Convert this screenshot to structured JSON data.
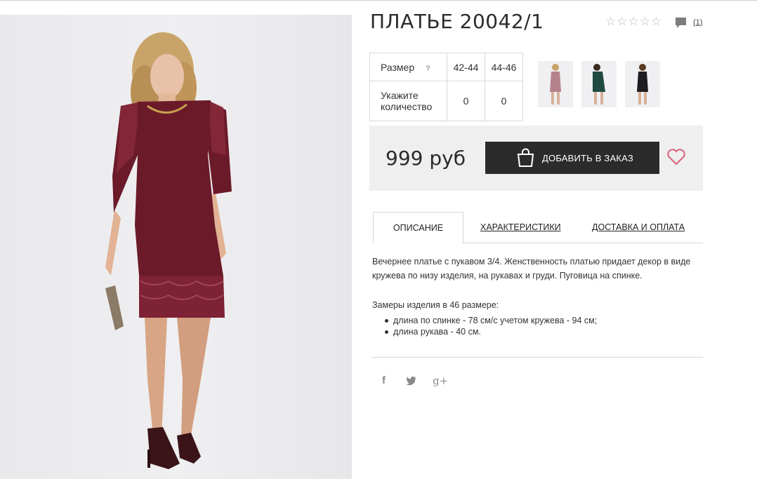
{
  "product": {
    "title": "ПЛАТЬЕ 20042/1",
    "rating_count": "(1)",
    "price": "999 руб"
  },
  "sizes": {
    "size_label": "Размер",
    "help_mark": "?",
    "qty_label": "Укажите количество",
    "columns": [
      "42-44",
      "44-46"
    ],
    "quantities": [
      "0",
      "0"
    ]
  },
  "actions": {
    "add_to_order": "ДОБАВИТЬ В ЗАКАЗ"
  },
  "tabs": [
    {
      "label": "ОПИСАНИЕ",
      "active": true
    },
    {
      "label": "ХАРАКТЕРИСТИКИ",
      "active": false
    },
    {
      "label": "ДОСТАВКА И ОПЛАТА",
      "active": false
    }
  ],
  "description": {
    "text": "Вечернее платье с пукавом 3/4. Женственность платью придает декор в виде кружева по низу изделия, на рукавах и груди. Пуговица на спинке.",
    "measures_title": "Замеры изделия в 46 размере:",
    "measures": [
      "длина по спинке - 78 см/с учетом кружева - 94 см;",
      "длина рукава - 40 см."
    ]
  },
  "thumbnails": [
    {
      "name": "burgundy",
      "color": "#8a3a48"
    },
    {
      "name": "green",
      "color": "#1f4a40"
    },
    {
      "name": "black",
      "color": "#1d1d1f"
    }
  ],
  "social": {
    "facebook": "f",
    "twitter": "t",
    "google": "g+"
  },
  "colors": {
    "dress": "#6b1a2a",
    "button": "#2b2b2b",
    "heart": "#d8607a",
    "price_box": "#efefef"
  }
}
